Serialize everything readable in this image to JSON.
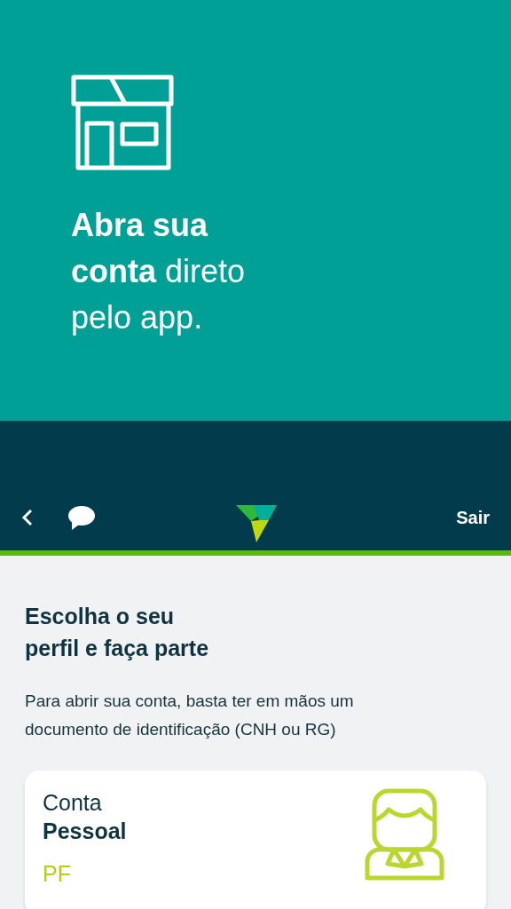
{
  "hero": {
    "headline_lines": [
      "**Abra sua**",
      "**conta** direto",
      "pelo app."
    ]
  },
  "nav": {
    "logout": "Sair"
  },
  "intro": {
    "title_lines": [
      "Escolha o seu",
      "perfil e faça parte"
    ],
    "description": "Para abrir sua conta, basta ter em mãos um documento de identificação (CNH ou RG)"
  },
  "profile_cards": [
    {
      "kind": "person",
      "line_1": "Conta",
      "line_2": "Pessoal",
      "code": "PF"
    }
  ]
}
